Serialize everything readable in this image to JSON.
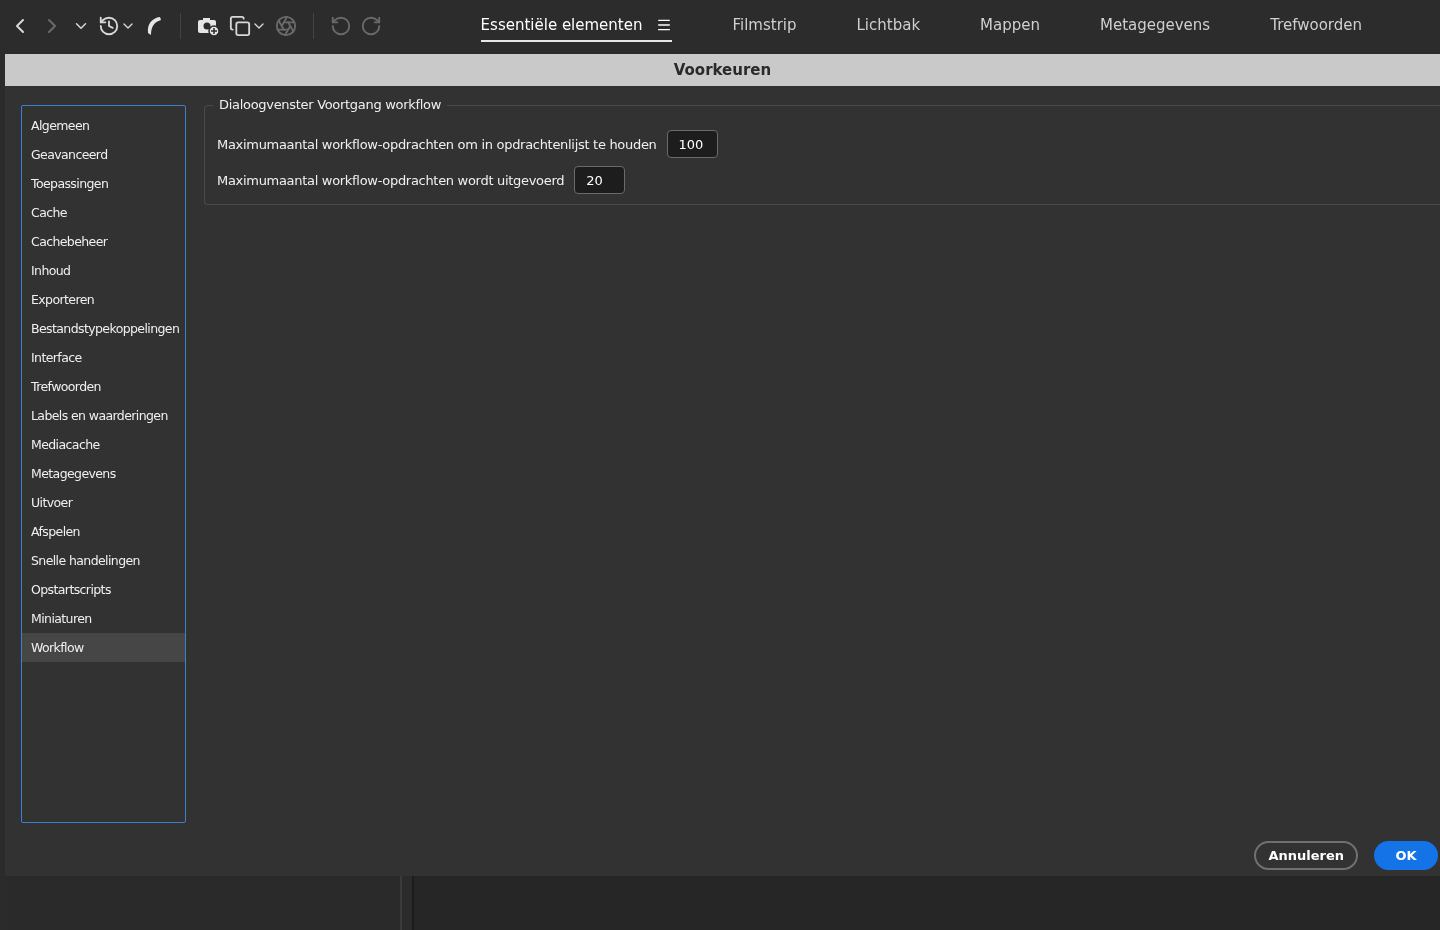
{
  "toolbar": {
    "workspaces": [
      {
        "label": "Essentiële elementen",
        "selected": true
      },
      {
        "label": "Filmstrip",
        "selected": false
      },
      {
        "label": "Lichtbak",
        "selected": false
      },
      {
        "label": "Mappen",
        "selected": false
      },
      {
        "label": "Metagegevens",
        "selected": false
      },
      {
        "label": "Trefwoorden",
        "selected": false
      }
    ]
  },
  "dialog": {
    "title": "Voorkeuren",
    "categories": [
      {
        "label": "Algemeen",
        "selected": false
      },
      {
        "label": "Geavanceerd",
        "selected": false
      },
      {
        "label": "Toepassingen",
        "selected": false
      },
      {
        "label": "Cache",
        "selected": false
      },
      {
        "label": "Cachebeheer",
        "selected": false
      },
      {
        "label": "Inhoud",
        "selected": false
      },
      {
        "label": "Exporteren",
        "selected": false
      },
      {
        "label": "Bestandstypekoppelingen",
        "selected": false
      },
      {
        "label": "Interface",
        "selected": false
      },
      {
        "label": "Trefwoorden",
        "selected": false
      },
      {
        "label": "Labels en waarderingen",
        "selected": false
      },
      {
        "label": "Mediacache",
        "selected": false
      },
      {
        "label": "Metagegevens",
        "selected": false
      },
      {
        "label": "Uitvoer",
        "selected": false
      },
      {
        "label": "Afspelen",
        "selected": false
      },
      {
        "label": "Snelle handelingen",
        "selected": false
      },
      {
        "label": "Opstartscripts",
        "selected": false
      },
      {
        "label": "Miniaturen",
        "selected": false
      },
      {
        "label": "Workflow",
        "selected": true
      }
    ],
    "group": {
      "title": "Dialoogvenster Voortgang workflow",
      "fields": [
        {
          "label": "Maximumaantal workflow-opdrachten om in opdrachtenlijst te houden",
          "value": "100"
        },
        {
          "label": "Maximumaantal workflow-opdrachten wordt uitgevoerd",
          "value": "20"
        }
      ]
    },
    "buttons": [
      {
        "label": "Annuleren",
        "kind": "secondary"
      },
      {
        "label": "OK",
        "kind": "primary"
      }
    ]
  }
}
